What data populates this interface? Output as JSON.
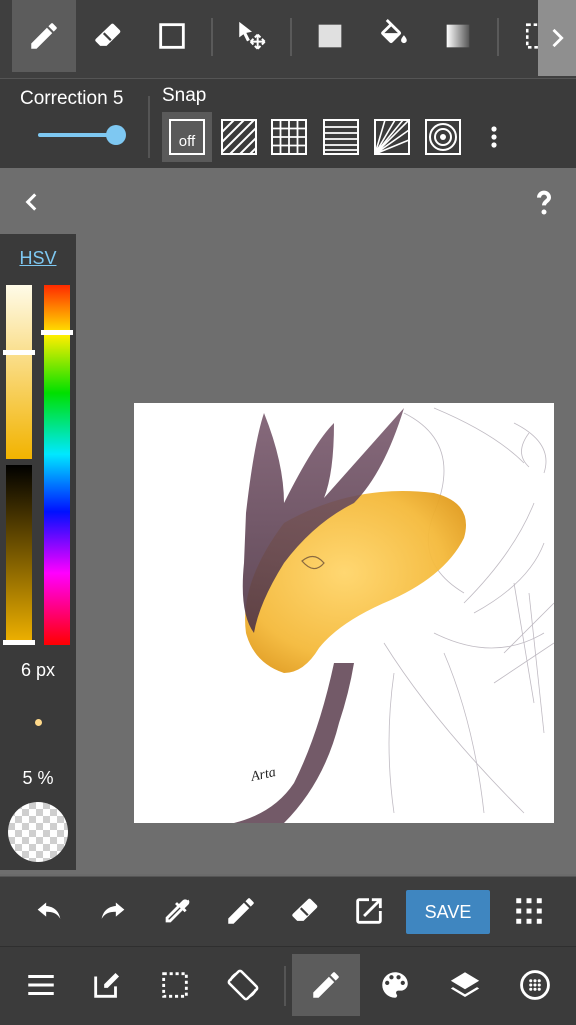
{
  "options": {
    "correction_label": "Correction 5",
    "correction_value": 5,
    "snap_label": "Snap",
    "snap_off_label": "off"
  },
  "color_panel": {
    "mode_label": "HSV",
    "brush_size": "6 px",
    "opacity": "5 %",
    "current_color": "#f2b300"
  },
  "actions": {
    "save_label": "SAVE"
  },
  "canvas": {
    "signature": "Arta"
  },
  "colors": {
    "accent": "#3f86c0",
    "slider": "#7ec8f2"
  }
}
